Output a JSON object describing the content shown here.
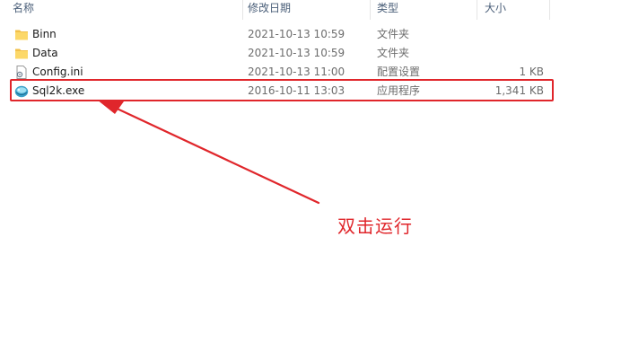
{
  "columns": {
    "name": "名称",
    "date": "修改日期",
    "type": "类型",
    "size": "大小"
  },
  "files": [
    {
      "name": "Binn",
      "date": "2021-10-13 10:59",
      "type": "文件夹",
      "size": "",
      "icon": "folder-icon"
    },
    {
      "name": "Data",
      "date": "2021-10-13 10:59",
      "type": "文件夹",
      "size": "",
      "icon": "folder-icon"
    },
    {
      "name": "Config.ini",
      "date": "2021-10-13 11:00",
      "type": "配置设置",
      "size": "1 KB",
      "icon": "config-file-icon"
    },
    {
      "name": "Sql2k.exe",
      "date": "2016-10-11 13:03",
      "type": "应用程序",
      "size": "1,341 KB",
      "icon": "sql-app-icon"
    }
  ],
  "annotation": {
    "text": "双击运行",
    "color": "#e0262b"
  }
}
